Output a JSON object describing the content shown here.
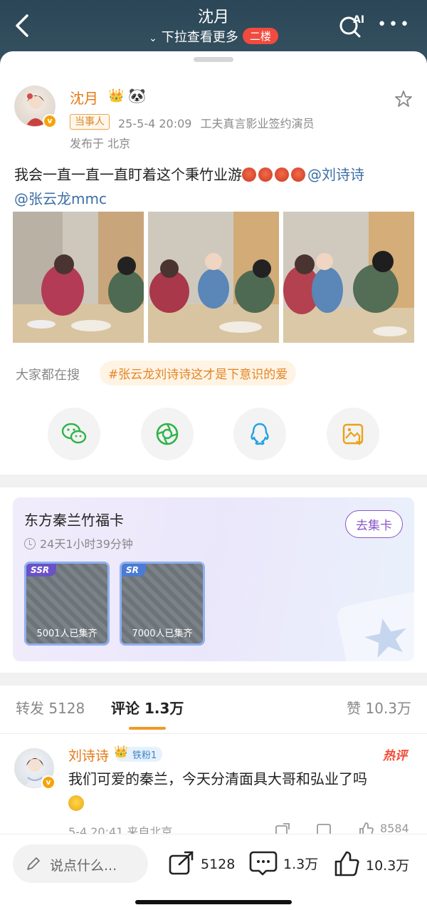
{
  "header": {
    "title": "沈月",
    "subtitle": "下拉查看更多",
    "floor_badge": "二楼"
  },
  "post": {
    "author": "沈月",
    "party_tag": "当事人",
    "time": "25-5-4 20:09",
    "source": "工夫真言影业签约演员",
    "location": "发布于 北京",
    "text_main": "我会一直一直一直盯着这个秉竹业游",
    "mention_1": "@刘诗诗",
    "mention_2": "@张云龙mmc"
  },
  "trending": {
    "label": "大家都在搜",
    "topic": "#张云龙刘诗诗这才是下意识的爱"
  },
  "share_buttons": [
    "wechat-icon",
    "moments-icon",
    "qq-icon",
    "save-image-icon"
  ],
  "card": {
    "title": "东方秦兰竹福卡",
    "time_left": "24天1小时39分钟",
    "collect_label": "去集卡",
    "items": [
      {
        "rank": "SSR",
        "count": "5001人已集齐"
      },
      {
        "rank": "SR",
        "count": "7000人已集齐"
      }
    ]
  },
  "tabs": {
    "repost": "转发 5128",
    "comments": "评论 1.3万",
    "likes": "赞 10.3万"
  },
  "comment": {
    "author": "刘诗诗",
    "fan_badge": "铁粉1",
    "hot_label": "热评",
    "text": "我们可爱的秦兰，今天分清面具大哥和弘业了吗",
    "meta": "5-4 20:41 来自北京",
    "like_count": "8584"
  },
  "bottombar": {
    "placeholder": "说点什么...",
    "repost_count": "5128",
    "comment_count": "1.3万",
    "like_count": "10.3万"
  },
  "colors": {
    "accent_orange": "#e67a17",
    "mention_blue": "#3a6ea5",
    "nav_bg": "#2b4757",
    "badge_red": "#f04b3e",
    "card_purple": "#8a57c8"
  }
}
